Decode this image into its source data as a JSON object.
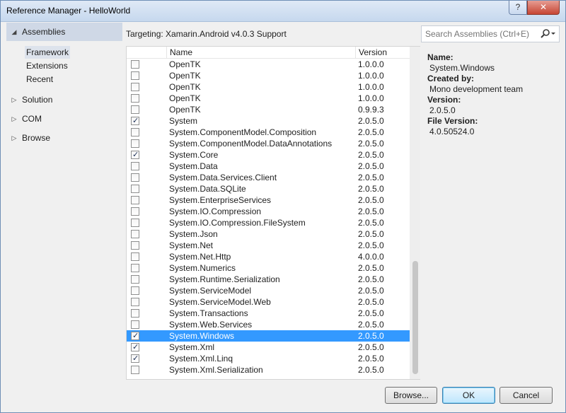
{
  "window": {
    "title": "Reference Manager - HelloWorld"
  },
  "titlebar": {
    "help": "?",
    "close": "✕"
  },
  "nav": {
    "assemblies": "Assemblies",
    "sub_items": [
      "Framework",
      "Extensions",
      "Recent"
    ],
    "solution": "Solution",
    "com": "COM",
    "browse": "Browse"
  },
  "targeting": "Targeting: Xamarin.Android v4.0.3 Support",
  "search": {
    "placeholder": "Search Assemblies (Ctrl+E)"
  },
  "list": {
    "columns": {
      "name": "Name",
      "version": "Version"
    },
    "rows": [
      {
        "checked": false,
        "name": "OpenTK",
        "version": "1.0.0.0"
      },
      {
        "checked": false,
        "name": "OpenTK",
        "version": "1.0.0.0"
      },
      {
        "checked": false,
        "name": "OpenTK",
        "version": "1.0.0.0"
      },
      {
        "checked": false,
        "name": "OpenTK",
        "version": "1.0.0.0"
      },
      {
        "checked": false,
        "name": "OpenTK",
        "version": "0.9.9.3"
      },
      {
        "checked": true,
        "name": "System",
        "version": "2.0.5.0"
      },
      {
        "checked": false,
        "name": "System.ComponentModel.Composition",
        "version": "2.0.5.0"
      },
      {
        "checked": false,
        "name": "System.ComponentModel.DataAnnotations",
        "version": "2.0.5.0"
      },
      {
        "checked": true,
        "name": "System.Core",
        "version": "2.0.5.0"
      },
      {
        "checked": false,
        "name": "System.Data",
        "version": "2.0.5.0"
      },
      {
        "checked": false,
        "name": "System.Data.Services.Client",
        "version": "2.0.5.0"
      },
      {
        "checked": false,
        "name": "System.Data.SQLite",
        "version": "2.0.5.0"
      },
      {
        "checked": false,
        "name": "System.EnterpriseServices",
        "version": "2.0.5.0"
      },
      {
        "checked": false,
        "name": "System.IO.Compression",
        "version": "2.0.5.0"
      },
      {
        "checked": false,
        "name": "System.IO.Compression.FileSystem",
        "version": "2.0.5.0"
      },
      {
        "checked": false,
        "name": "System.Json",
        "version": "2.0.5.0"
      },
      {
        "checked": false,
        "name": "System.Net",
        "version": "2.0.5.0"
      },
      {
        "checked": false,
        "name": "System.Net.Http",
        "version": "4.0.0.0"
      },
      {
        "checked": false,
        "name": "System.Numerics",
        "version": "2.0.5.0"
      },
      {
        "checked": false,
        "name": "System.Runtime.Serialization",
        "version": "2.0.5.0"
      },
      {
        "checked": false,
        "name": "System.ServiceModel",
        "version": "2.0.5.0"
      },
      {
        "checked": false,
        "name": "System.ServiceModel.Web",
        "version": "2.0.5.0"
      },
      {
        "checked": false,
        "name": "System.Transactions",
        "version": "2.0.5.0"
      },
      {
        "checked": false,
        "name": "System.Web.Services",
        "version": "2.0.5.0"
      },
      {
        "checked": true,
        "name": "System.Windows",
        "version": "2.0.5.0",
        "selected": true
      },
      {
        "checked": true,
        "name": "System.Xml",
        "version": "2.0.5.0"
      },
      {
        "checked": true,
        "name": "System.Xml.Linq",
        "version": "2.0.5.0"
      },
      {
        "checked": false,
        "name": "System.Xml.Serialization",
        "version": "2.0.5.0"
      }
    ]
  },
  "details": {
    "name_label": "Name:",
    "name_value": "System.Windows",
    "created_label": "Created by:",
    "created_value": "Mono development team",
    "version_label": "Version:",
    "version_value": "2.0.5.0",
    "file_version_label": "File Version:",
    "file_version_value": "4.0.50524.0"
  },
  "buttons": {
    "browse": "Browse...",
    "ok": "OK",
    "cancel": "Cancel"
  },
  "colors": {
    "selection": "#3399ff",
    "nav_selected": "#cfd8e6",
    "primary_button": "#bee6fd"
  },
  "icons": {
    "search": "search-icon",
    "expand": "expand-arrow-icon",
    "collapse": "collapse-arrow-icon"
  }
}
